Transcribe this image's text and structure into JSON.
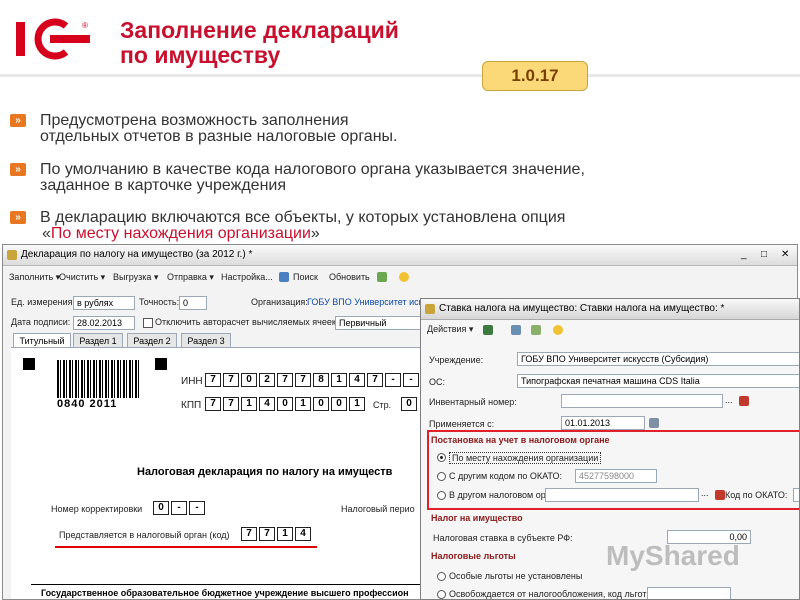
{
  "header": {
    "logo_text": "1С",
    "title_line1": "Заполнение деклараций",
    "title_line2": "по имуществу",
    "version": "1.0.17"
  },
  "bullets": [
    {
      "line1": "Предусмотрена возможность заполнения",
      "line2": "отдельных отчетов в разные налоговые органы."
    },
    {
      "line1": "По умолчанию в качестве кода налогового органа указывается значение,",
      "line2": "заданное в карточке учреждения"
    },
    {
      "line1": "В декларацию включаются все объекты, у которых установлена опция",
      "line2_pre": "«",
      "line2_hl": "По месту нахождения организации",
      "line2_post": "»"
    }
  ],
  "main_window": {
    "title": "Декларация по налогу на имущество (за 2012 г.) *",
    "toolbar": [
      "Заполнить ▾",
      "Очистить ▾",
      "Выгрузка ▾",
      "Отправка ▾",
      "Настройка...",
      "Поиск",
      "Обновить"
    ],
    "unit_label": "Ед. измерения:",
    "unit_value": "в рублях",
    "precision_label": "Точность:",
    "precision_value": "0",
    "org_label": "Организация:",
    "org_value": "ГОБУ ВПО Университет искусств",
    "date_label": "Дата подписи:",
    "date_value": "28.02.2013",
    "autocalc_label": "Отключить авторасчет вычисляемых ячеек",
    "kind_value": "Первичный",
    "tabs": [
      "Титульный",
      "Раздел 1",
      "Раздел 2",
      "Раздел 3"
    ],
    "barcode_number": "0840 2011",
    "inn_label": "ИНН",
    "inn_cells": [
      "7",
      "7",
      "0",
      "2",
      "7",
      "7",
      "8",
      "1",
      "4",
      "7",
      "-",
      "-"
    ],
    "kpp_label": "КПП",
    "kpp_cells": [
      "7",
      "7",
      "1",
      "4",
      "0",
      "1",
      "0",
      "0",
      "1"
    ],
    "page_label": "Стр.",
    "page_cell": "0",
    "doc_title": "Налоговая декларация по налогу на имуществ",
    "corr_label": "Номер корректировки",
    "corr_cells": [
      "0",
      "-",
      "-"
    ],
    "period_label": "Налоговый перио",
    "authority_label": "Представляется в налоговый орган (код)",
    "authority_cells": [
      "7",
      "7",
      "1",
      "4"
    ],
    "footer_text": "Государственное образовательное бюджетное учреждение высшего профессион"
  },
  "sub_window": {
    "title": "Ставка налога на имущество: Ставки налога на имущество: *",
    "actions_label": "Действия ▾",
    "inst_label": "Учреждение:",
    "inst_value": "ГОБУ ВПО Университет искусств (Субсидия)",
    "os_label": "ОС:",
    "os_value": "Типографская печатная машина CDS Italia",
    "inv_label": "Инвентарный номер:",
    "inv_value": "",
    "applied_label": "Применяется с:",
    "applied_value": "01.01.2013",
    "sec_registration": "Постановка на учет в налоговом органе",
    "radio1": "По месту нахождения организации",
    "radio2": "С другим кодом по ОКАТО:",
    "okato_value": "45277598000",
    "radio3": "В другом налоговом органе",
    "okato_code_label": "Код по ОКАТО:",
    "sec_tax": "Налог на имущество",
    "rate_label": "Налоговая ставка в субъекте РФ:",
    "rate_value": "0,00",
    "sec_benefits": "Налоговые льготы",
    "benefit1": "Особые льготы не установлены",
    "benefit2": "Освобождается от налогообложения, код льготы:"
  },
  "watermark": "MyShared",
  "colors": {
    "accent": "#c8102e",
    "bullet": "#e87722",
    "version_bg": "#fbd979"
  }
}
